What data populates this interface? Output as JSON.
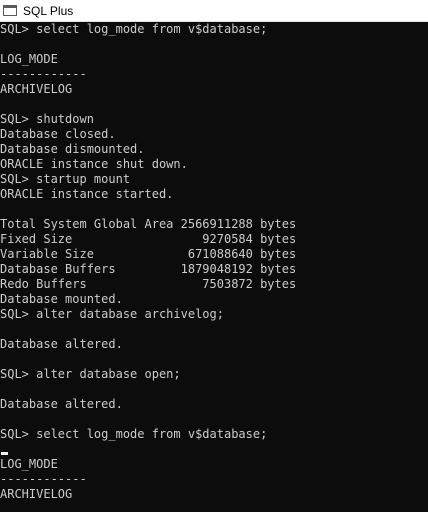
{
  "window": {
    "title": "SQL Plus",
    "icon": "console-window-icon"
  },
  "console": {
    "lines": [
      "SQL> select log_mode from v$database;",
      "",
      "LOG_MODE",
      "------------",
      "ARCHIVELOG",
      "",
      "SQL> shutdown",
      "Database closed.",
      "Database dismounted.",
      "ORACLE instance shut down.",
      "SQL> startup mount",
      "ORACLE instance started.",
      "",
      "Total System Global Area 2566911288 bytes",
      "Fixed Size                  9270584 bytes",
      "Variable Size             671088640 bytes",
      "Database Buffers         1879048192 bytes",
      "Redo Buffers                7503872 bytes",
      "Database mounted.",
      "SQL> alter database archivelog;",
      "",
      "Database altered.",
      "",
      "SQL> alter database open;",
      "",
      "Database altered.",
      "",
      "SQL> select log_mode from v$database;",
      "",
      "LOG_MODE",
      "------------",
      "ARCHIVELOG"
    ]
  }
}
